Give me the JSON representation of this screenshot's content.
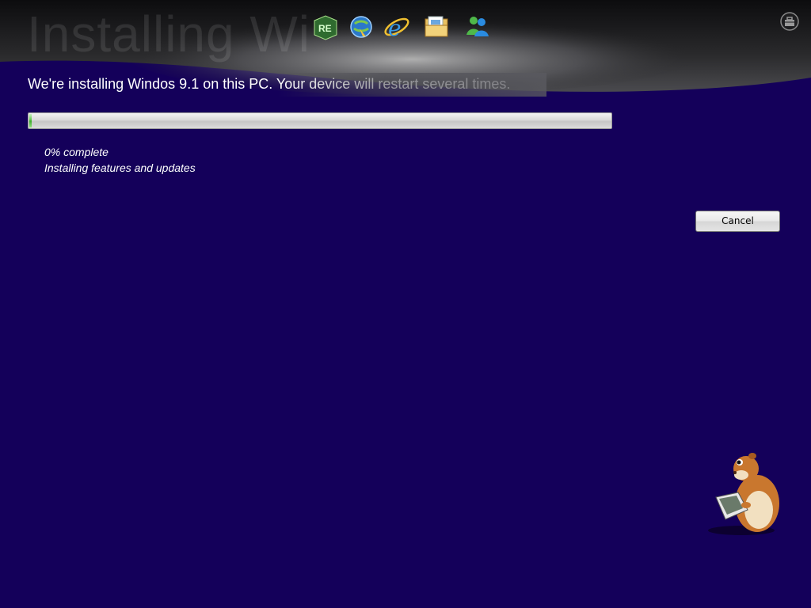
{
  "ghost_title": "Installing Wi",
  "headline": "We're installing Windos 9.1 on this PC. Your device will restart several times.",
  "progress": {
    "percent": 0.4
  },
  "status": {
    "percent_text": "0% complete",
    "task_text": "Installing features and updates"
  },
  "buttons": {
    "cancel_label": "Cancel"
  },
  "dock_icons": [
    "mixed-reality-icon",
    "browser-globe-icon",
    "internet-explorer-icon",
    "folder-icon",
    "messenger-icon"
  ],
  "corner_icon": "toolbox-icon",
  "colors": {
    "background": "#14005a",
    "header": "#1a1a1c",
    "progress_fill": "#4fbf3a"
  }
}
